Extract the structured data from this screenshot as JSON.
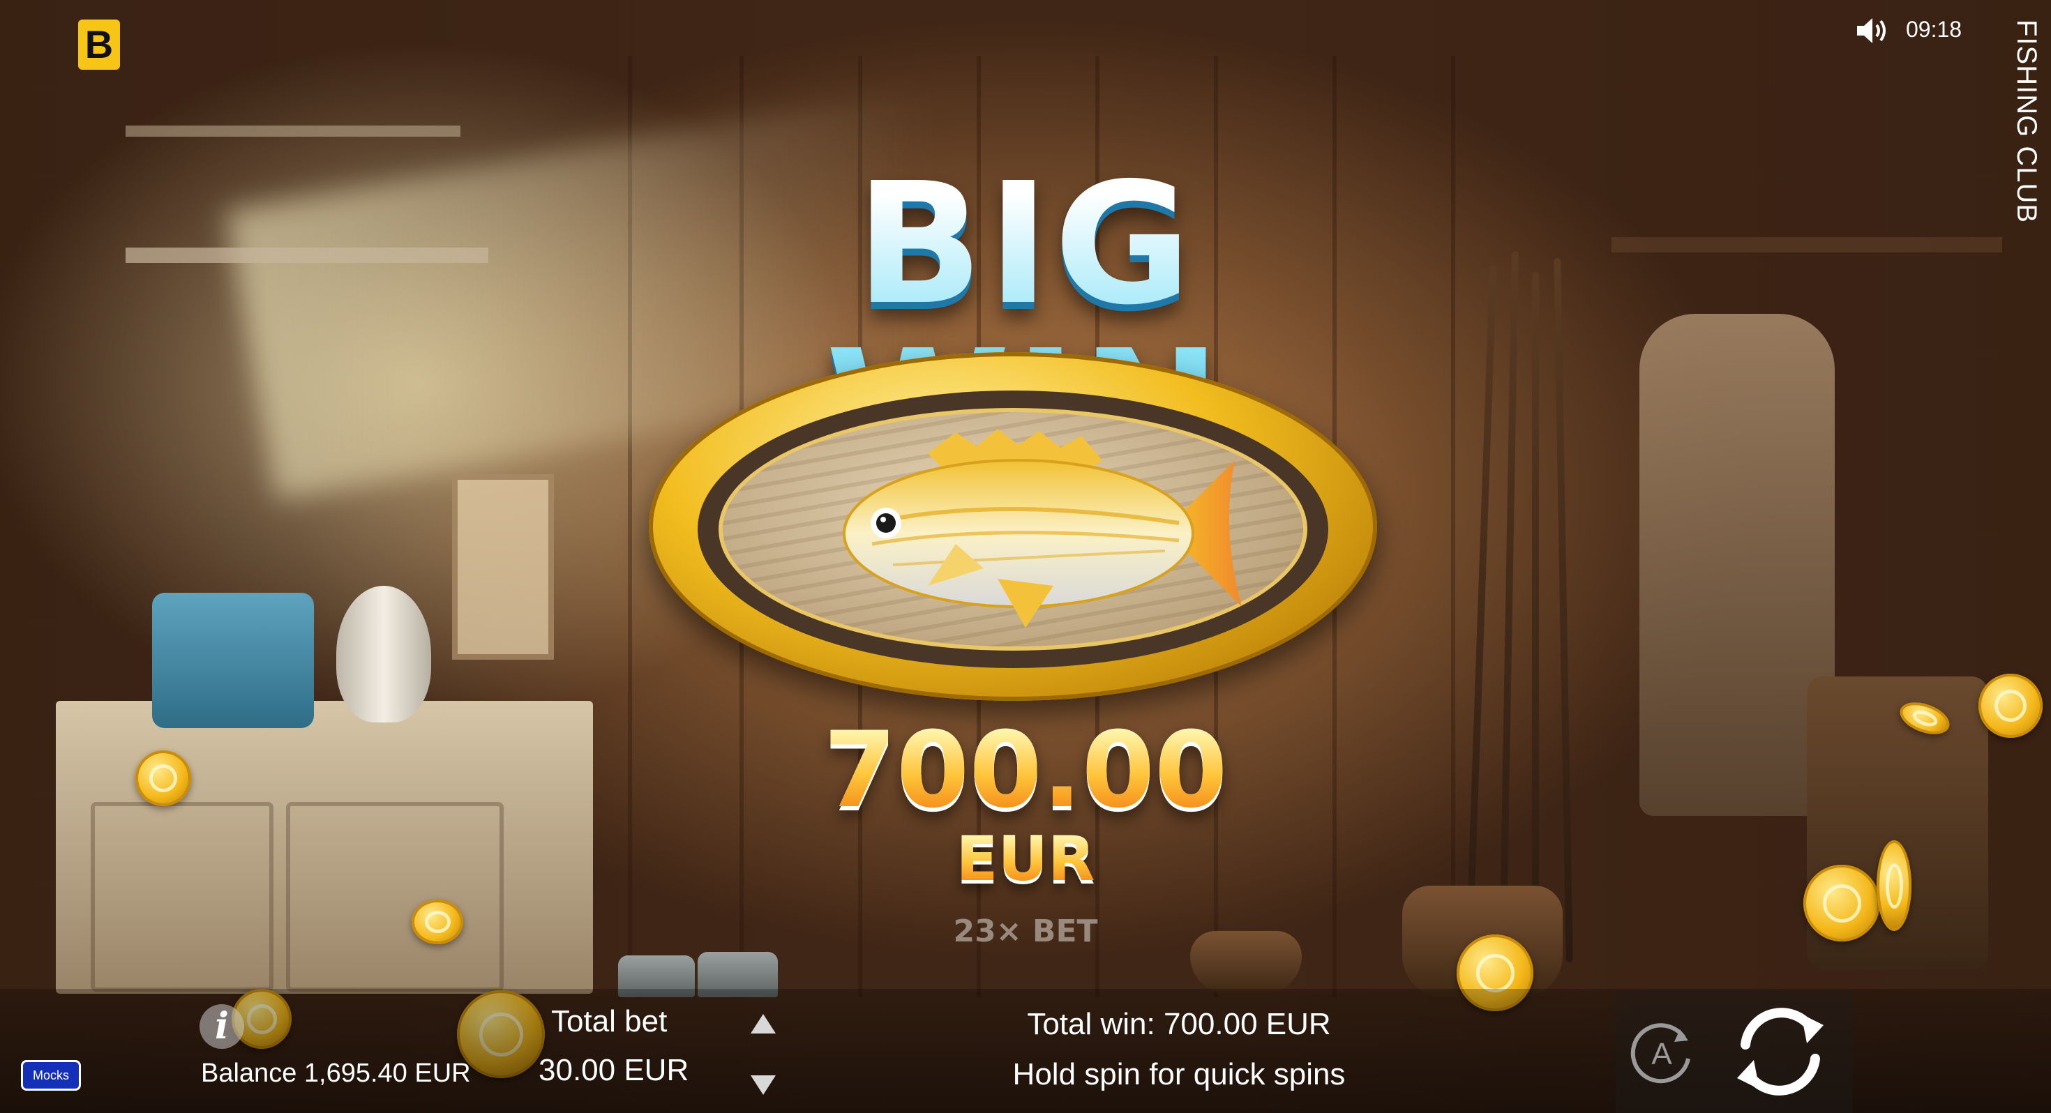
{
  "brand": {
    "logo_letter": "B",
    "accent": "#f6c515"
  },
  "header": {
    "time": "09:18",
    "sound_icon": "speaker-icon",
    "game_title": "FISHING CLUB"
  },
  "win_popup": {
    "title": "BIG WIN",
    "amount": "700.00",
    "currency": "EUR",
    "multiplier": "23× BET",
    "trophy_icon": "mounted-fish-plaque"
  },
  "bottom_bar": {
    "info_icon_label": "i",
    "balance": "Balance 1,695.40 EUR",
    "total_bet_label": "Total bet",
    "total_bet_value": "30.00 EUR",
    "bet_up_icon": "triangle-up-icon",
    "bet_down_icon": "triangle-down-icon",
    "total_win": "Total win: 700.00 EUR",
    "hint": "Hold spin for quick spins",
    "autoplay_label": "A",
    "spin_icon": "refresh-arrows-icon"
  },
  "badge": {
    "mocks": "Mocks",
    "color": "#1530b8"
  }
}
